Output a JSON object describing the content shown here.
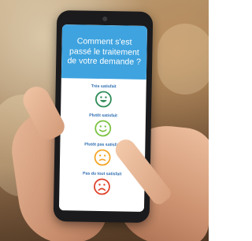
{
  "survey": {
    "question": "Comment s'est passé le traitement de votre demande ?",
    "options": [
      {
        "label": "Très satisfait",
        "icon": "very-happy-face-icon",
        "color": "#2e8b57"
      },
      {
        "label": "Plutôt satisfait",
        "icon": "smiling-face-icon",
        "color": "#7cc242"
      },
      {
        "label": "Plutôt pas satisfait",
        "icon": "neutral-face-icon",
        "color": "#f4a62a"
      },
      {
        "label": "Pas du tout satisfait",
        "icon": "frowning-face-icon",
        "color": "#e0432b"
      }
    ]
  },
  "colors": {
    "header": "#3fa3df",
    "label": "#2b6cb0"
  }
}
